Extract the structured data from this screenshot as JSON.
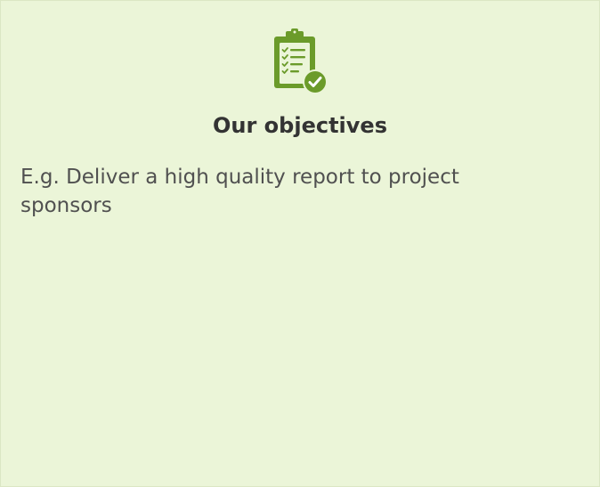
{
  "card": {
    "title": "Our objectives",
    "body_text": "E.g. Deliver a high quality report to project sponsors",
    "icon": "clipboard-check-icon",
    "colors": {
      "background": "#ebf5d8",
      "accent": "#6b9b2a",
      "title": "#333333",
      "body": "#505050"
    }
  }
}
